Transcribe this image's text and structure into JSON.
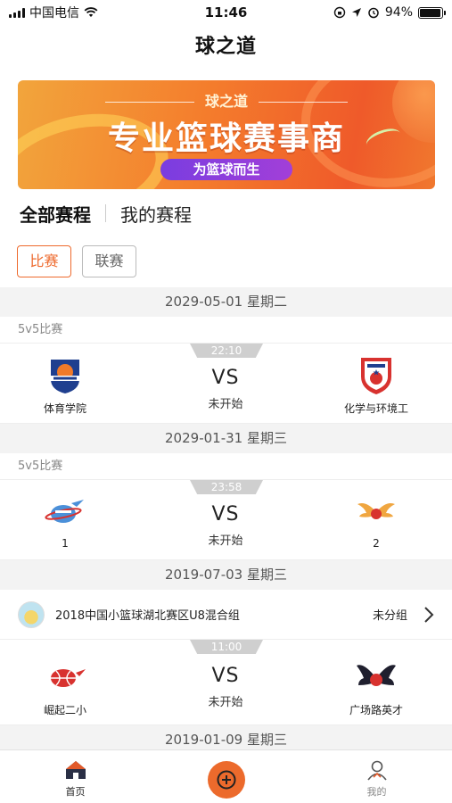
{
  "status_bar": {
    "carrier": "中国电信",
    "time": "11:46",
    "battery": "94%",
    "battery_level": 0.94
  },
  "nav": {
    "title": "球之道"
  },
  "banner": {
    "small_title": "球之道",
    "main_text": "专业篮球赛事商",
    "pill_text": "为篮球而生"
  },
  "tabs": [
    {
      "label": "全部赛程",
      "active": true
    },
    {
      "label": "我的赛程",
      "active": false
    }
  ],
  "filters": [
    {
      "label": "比赛",
      "active": true
    },
    {
      "label": "联赛",
      "active": false
    }
  ],
  "sections": [
    {
      "date": "2029-05-01 星期二",
      "group": "5v5比赛",
      "match": {
        "time": "22:10",
        "vs": "VS",
        "status": "未开始",
        "home": "体育学院",
        "away": "化学与环境工"
      }
    },
    {
      "date": "2029-01-31 星期三",
      "group": "5v5比赛",
      "match": {
        "time": "23:58",
        "vs": "VS",
        "status": "未开始",
        "home": "1",
        "away": "2"
      }
    },
    {
      "date": "2019-07-03 星期三",
      "league": {
        "name": "2018中国小篮球湖北赛区U8混合组",
        "group": "未分组"
      },
      "match": {
        "time": "11:00",
        "vs": "VS",
        "status": "未开始",
        "home": "崛起二小",
        "away": "广场路英才"
      }
    },
    {
      "date": "2019-01-09 星期三"
    }
  ],
  "tabbar": {
    "home": "首页",
    "mine": "我的"
  },
  "colors": {
    "accent": "#ec6a2c",
    "date_bg": "#f3f3f3"
  }
}
